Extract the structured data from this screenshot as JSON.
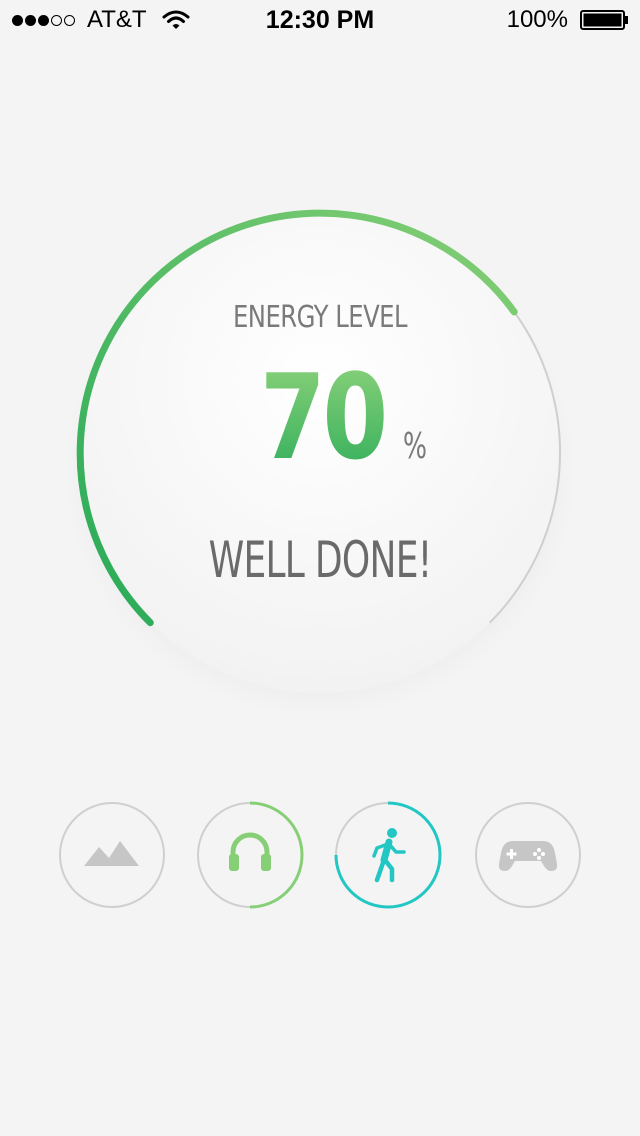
{
  "status_bar": {
    "carrier": "AT&T",
    "time": "12:30 PM",
    "battery_percent": "100%",
    "signal_bars_filled": 3,
    "signal_bars_total": 5
  },
  "gauge": {
    "label": "ENERGY LEVEL",
    "value": "70",
    "unit": "%",
    "level_fraction": 0.7,
    "message": "WELL DONE!",
    "colors": {
      "start": "#2fad5a",
      "end": "#7ccb72",
      "track": "#cfcfcf"
    }
  },
  "nav": {
    "items": [
      {
        "name": "landscape-icon",
        "progress": 0,
        "color": "#c6c6c6",
        "active": false
      },
      {
        "name": "headphones-icon",
        "progress": 0.5,
        "color": "#86cf77",
        "active": false
      },
      {
        "name": "walking-icon",
        "progress": 0.75,
        "color": "#22c6c3",
        "active": true
      },
      {
        "name": "gamepad-icon",
        "progress": 0,
        "color": "#c6c6c6",
        "active": false
      }
    ]
  }
}
